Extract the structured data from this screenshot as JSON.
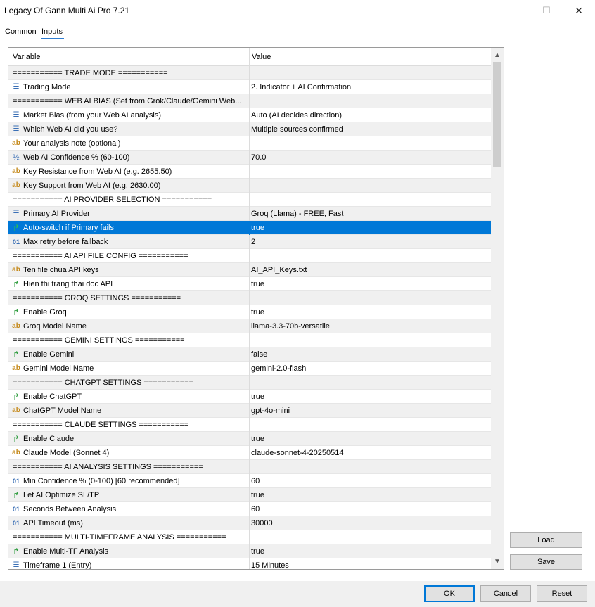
{
  "window": {
    "title": "Legacy Of Gann Multi Ai Pro 7.21",
    "minimize": "—",
    "maximize": "☐",
    "close": "✕"
  },
  "tabs": [
    {
      "label": "Common"
    },
    {
      "label": "Inputs"
    }
  ],
  "grid": {
    "col_variable": "Variable",
    "col_value": "Value",
    "rows": [
      {
        "type": "section",
        "name": "=========== TRADE MODE ===========",
        "value": ""
      },
      {
        "type": "enum",
        "name": "Trading Mode",
        "value": "2. Indicator + AI Confirmation"
      },
      {
        "type": "section",
        "name": "=========== WEB AI BIAS (Set from Grok/Claude/Gemini Web...",
        "value": ""
      },
      {
        "type": "enum",
        "name": "Market Bias (from your Web AI analysis)",
        "value": "Auto (AI decides direction)"
      },
      {
        "type": "enum",
        "name": "Which Web AI did you use?",
        "value": "Multiple sources confirmed"
      },
      {
        "type": "string",
        "name": "Your analysis note (optional)",
        "value": ""
      },
      {
        "type": "double",
        "name": "Web AI Confidence % (60-100)",
        "value": "70.0"
      },
      {
        "type": "string",
        "name": "Key Resistance from Web AI (e.g. 2655.50)",
        "value": ""
      },
      {
        "type": "string",
        "name": "Key Support from Web AI (e.g. 2630.00)",
        "value": ""
      },
      {
        "type": "section",
        "name": "=========== AI PROVIDER SELECTION ===========",
        "value": ""
      },
      {
        "type": "enum",
        "name": "Primary AI Provider",
        "value": "Groq (Llama) - FREE, Fast"
      },
      {
        "type": "bool",
        "name": "Auto-switch if Primary fails",
        "value": "true",
        "selected": true
      },
      {
        "type": "int",
        "name": "Max retry before fallback",
        "value": "2"
      },
      {
        "type": "section",
        "name": "=========== AI API FILE CONFIG ===========",
        "value": ""
      },
      {
        "type": "string",
        "name": "Ten file chua API keys",
        "value": "AI_API_Keys.txt"
      },
      {
        "type": "bool",
        "name": "Hien thi trang thai doc API",
        "value": "true"
      },
      {
        "type": "section",
        "name": "=========== GROQ SETTINGS ===========",
        "value": ""
      },
      {
        "type": "bool",
        "name": "Enable Groq",
        "value": "true"
      },
      {
        "type": "string",
        "name": "Groq Model Name",
        "value": "llama-3.3-70b-versatile"
      },
      {
        "type": "section",
        "name": "=========== GEMINI SETTINGS ===========",
        "value": ""
      },
      {
        "type": "bool",
        "name": "Enable Gemini",
        "value": "false"
      },
      {
        "type": "string",
        "name": "Gemini Model Name",
        "value": "gemini-2.0-flash"
      },
      {
        "type": "section",
        "name": "=========== CHATGPT SETTINGS ===========",
        "value": ""
      },
      {
        "type": "bool",
        "name": "Enable ChatGPT",
        "value": "true"
      },
      {
        "type": "string",
        "name": "ChatGPT Model Name",
        "value": "gpt-4o-mini"
      },
      {
        "type": "section",
        "name": "=========== CLAUDE SETTINGS ===========",
        "value": ""
      },
      {
        "type": "bool",
        "name": "Enable Claude",
        "value": "true"
      },
      {
        "type": "string",
        "name": "Claude Model (Sonnet 4)",
        "value": "claude-sonnet-4-20250514"
      },
      {
        "type": "section",
        "name": "=========== AI ANALYSIS SETTINGS ===========",
        "value": ""
      },
      {
        "type": "int",
        "name": "Min Confidence % (0-100) [60 recommended]",
        "value": "60"
      },
      {
        "type": "bool",
        "name": "Let AI Optimize SL/TP",
        "value": "true"
      },
      {
        "type": "int",
        "name": "Seconds Between Analysis",
        "value": "60"
      },
      {
        "type": "int",
        "name": "API Timeout (ms)",
        "value": "30000"
      },
      {
        "type": "section",
        "name": "=========== MULTI-TIMEFRAME ANALYSIS ===========",
        "value": ""
      },
      {
        "type": "bool",
        "name": "Enable Multi-TF Analysis",
        "value": "true"
      },
      {
        "type": "enum",
        "name": "Timeframe 1 (Entry)",
        "value": "15 Minutes"
      }
    ]
  },
  "icons": {
    "enum": "☰",
    "string": "ab",
    "double": "½",
    "bool": "↱",
    "int": "01"
  },
  "buttons": {
    "load": "Load",
    "save": "Save",
    "ok": "OK",
    "cancel": "Cancel",
    "reset": "Reset"
  },
  "colors": {
    "selection": "#0078d7",
    "tab_accent": "#2f7dd1"
  }
}
